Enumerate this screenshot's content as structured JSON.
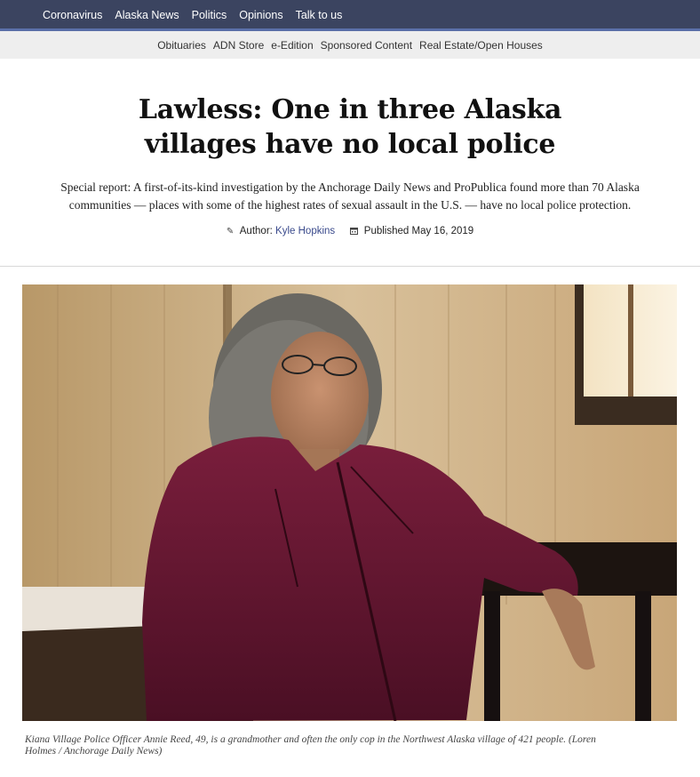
{
  "topnav": {
    "items": [
      "Coronavirus",
      "Alaska News",
      "Politics",
      "Opinions",
      "Talk to us"
    ]
  },
  "subnav": {
    "items": [
      "Obituaries",
      "ADN Store",
      "e-Edition",
      "Sponsored Content",
      "Real Estate/Open Houses"
    ]
  },
  "article": {
    "headline_line1": "Lawless: One in three Alaska",
    "headline_line2": "villages have no local police",
    "dek_line1": "Special report: A first-of-its-kind investigation by the Anchorage Daily News and ProPublica found more than 70 Alaska",
    "dek_line2": "communities — places with some of the highest rates of sexual assault in the U.S. — have no local police protection.",
    "author_label": "Author:",
    "author_name": "Kyle Hopkins",
    "published_label": "Published",
    "published_date": "May 16, 2019",
    "caption_line1": "Kiana Village Police Officer Annie Reed, 49, is a grandmother and often the only cop in the Northwest Alaska village of 421 people. (Loren",
    "caption_line2": "Holmes / Anchorage Daily News)"
  },
  "icons": {
    "author": "pencil-icon",
    "published": "calendar-icon"
  },
  "colors": {
    "topnav_bg": "#3b4460",
    "topnav_accent": "#5a6fa8",
    "link": "#3a4a8c"
  }
}
